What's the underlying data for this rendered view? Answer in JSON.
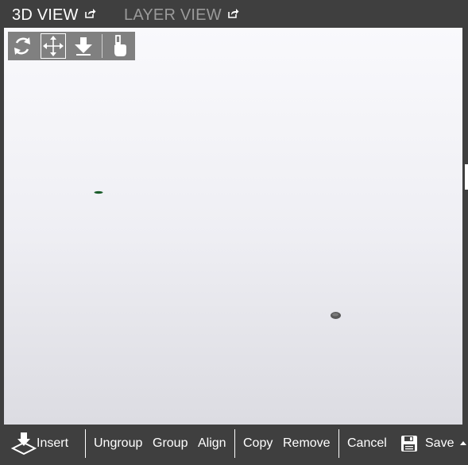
{
  "tabs": {
    "view_3d": "3D VIEW",
    "layer_view": "LAYER VIEW"
  },
  "mode_toolbar": {
    "buttons": [
      {
        "name": "rotate",
        "icon": "rotate-icon",
        "active": false
      },
      {
        "name": "pan",
        "icon": "move-arrows-icon",
        "active": true
      },
      {
        "name": "drop-to-floor",
        "icon": "down-arrow-icon",
        "active": false
      },
      {
        "name": "select",
        "icon": "hand-pointer-icon",
        "active": false
      }
    ]
  },
  "scene": {
    "objects": [
      {
        "name": "green-object",
        "color": "#1a5c2a"
      },
      {
        "name": "dark-object",
        "color": "#555555"
      }
    ]
  },
  "bottom_bar": {
    "insert": "Insert",
    "ungroup": "Ungroup",
    "group": "Group",
    "align": "Align",
    "copy": "Copy",
    "remove": "Remove",
    "cancel": "Cancel",
    "save": "Save"
  },
  "colors": {
    "chrome": "#3f3f3f",
    "toolbar": "#808080",
    "active_tab": "#ffffff",
    "inactive_tab": "#9a9a9a"
  }
}
